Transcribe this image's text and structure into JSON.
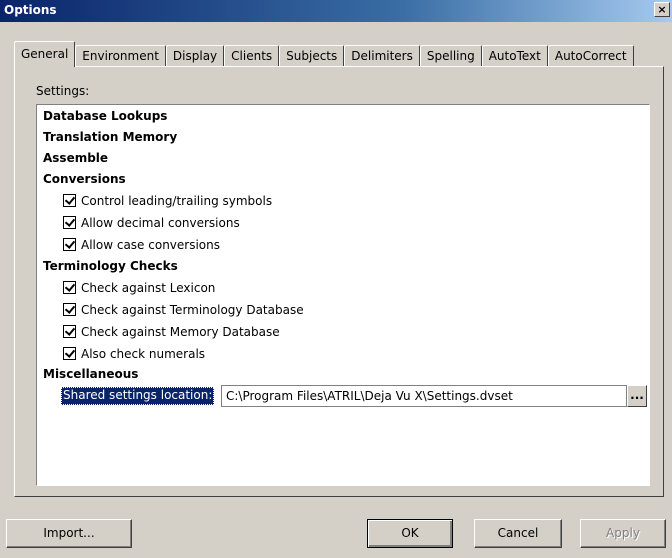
{
  "window": {
    "title": "Options",
    "close_glyph": "×"
  },
  "tabs": [
    {
      "label": "General",
      "active": true
    },
    {
      "label": "Environment"
    },
    {
      "label": "Display"
    },
    {
      "label": "Clients"
    },
    {
      "label": "Subjects"
    },
    {
      "label": "Delimiters"
    },
    {
      "label": "Spelling"
    },
    {
      "label": "AutoText"
    },
    {
      "label": "AutoCorrect"
    }
  ],
  "settings": {
    "label": "Settings:",
    "sections": {
      "database_lookups": "Database Lookups",
      "translation_memory": "Translation Memory",
      "assemble": "Assemble",
      "conversions": "Conversions",
      "terminology_checks": "Terminology Checks",
      "miscellaneous": "Miscellaneous"
    },
    "conversions": [
      {
        "label": "Control leading/trailing symbols",
        "checked": true
      },
      {
        "label": "Allow decimal conversions",
        "checked": true
      },
      {
        "label": "Allow case conversions",
        "checked": true
      }
    ],
    "terminology": [
      {
        "label": "Check against Lexicon",
        "checked": true
      },
      {
        "label": "Check against Terminology Database",
        "checked": true
      },
      {
        "label": "Check against Memory Database",
        "checked": true
      },
      {
        "label": "Also check numerals",
        "checked": true
      }
    ],
    "shared_location": {
      "label": "Shared settings location:",
      "value": "C:\\Program Files\\ATRIL\\Deja Vu X\\Settings.dvset",
      "browse_label": "..."
    }
  },
  "buttons": {
    "import": "Import...",
    "ok": "OK",
    "cancel": "Cancel",
    "apply": "Apply"
  }
}
